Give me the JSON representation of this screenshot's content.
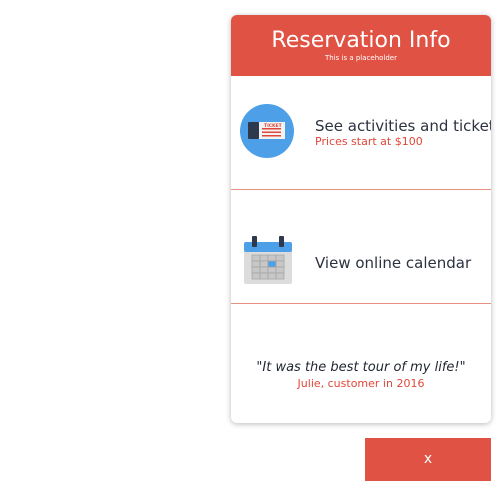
{
  "panel": {
    "title": "Reservation Info",
    "subtitle": "This is a placeholder"
  },
  "activities": {
    "title": "See activities and tickets",
    "subtitle": "Prices start at $100",
    "icon": "ticket-icon",
    "icon_text": "TICKET"
  },
  "calendar": {
    "title": "View online calendar",
    "icon": "calendar-icon"
  },
  "testimonial": {
    "quote": "\"It was the best tour of my life!\"",
    "author": "Julie, customer in 2016"
  },
  "close_button": {
    "label": "x"
  },
  "colors": {
    "accent": "#e05243",
    "accent_text": "#e0473a",
    "ticket_circle": "#4d9fe8",
    "calendar_blue": "#4d9fe8"
  }
}
